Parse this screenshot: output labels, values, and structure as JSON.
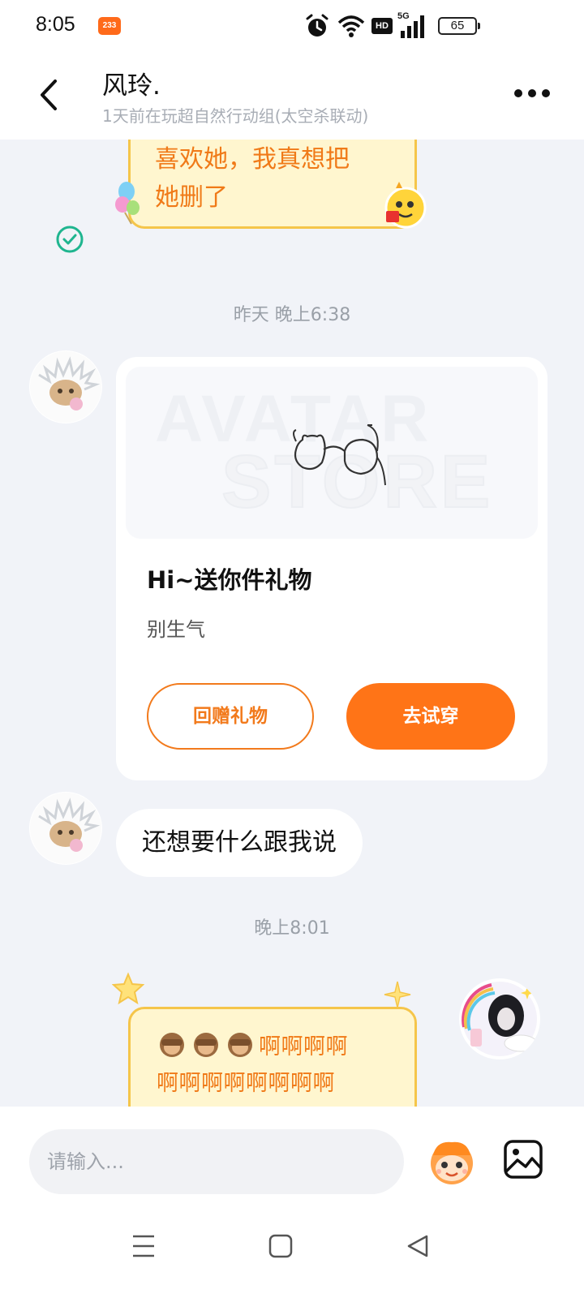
{
  "status_bar": {
    "time": "8:05",
    "app_badge": "233",
    "hd_label": "HD",
    "network_label": "5G",
    "battery_level": "65"
  },
  "header": {
    "name": "风玲.",
    "status": "1天前在玩超自然行动组(太空杀联动)"
  },
  "messages": {
    "first_bubble": {
      "line1": "喜欢她，我真想把",
      "line2": "她删了"
    },
    "timestamp_1": "昨天 晚上6:38",
    "gift_card": {
      "watermark_top": "AVATAR",
      "watermark_bottom": "STORE",
      "title": "Hi~送你件礼物",
      "subtitle": "别生气",
      "return_gift_label": "回赠礼物",
      "try_on_label": "去试穿"
    },
    "reply_text": "还想要什么跟我说",
    "timestamp_2": "晚上8:01",
    "last_bubble": {
      "line1_text": "啊啊啊啊",
      "line2": "啊啊啊啊啊啊啊啊"
    }
  },
  "input": {
    "placeholder": "请输入..."
  },
  "colors": {
    "accent": "#ff7417",
    "bubble_fill": "#fff6cf",
    "bubble_border": "#f5c54a",
    "bubble_text": "#f07a18",
    "background": "#f1f3f8"
  },
  "icons": {
    "back": "chevron-left-icon",
    "more": "more-dots-icon",
    "read": "check-circle-icon",
    "emoji": "mascot-emoji-icon",
    "image": "image-icon"
  }
}
